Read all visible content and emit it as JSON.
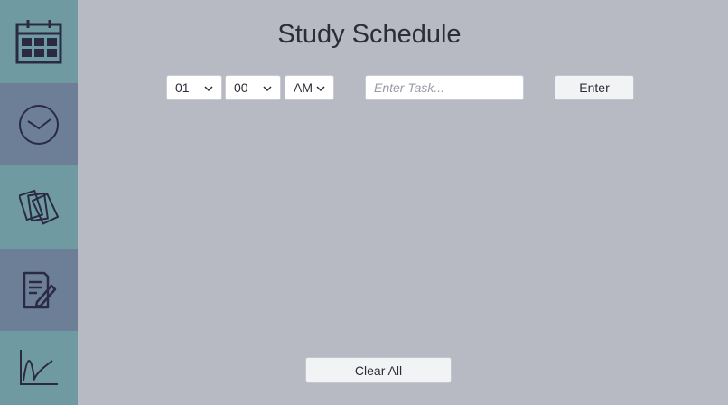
{
  "app": {
    "title": "Study Schedule"
  },
  "sidebar": {
    "items": [
      {
        "name": "calendar",
        "icon": "calendar-icon"
      },
      {
        "name": "clock",
        "icon": "clock-icon"
      },
      {
        "name": "cards",
        "icon": "flashcards-icon"
      },
      {
        "name": "notes",
        "icon": "notes-edit-icon"
      },
      {
        "name": "graph",
        "icon": "graph-icon"
      }
    ],
    "colors": {
      "teal": "#6f9aa1",
      "slate": "#6c7f96"
    }
  },
  "form": {
    "hour": {
      "value": "01"
    },
    "minute": {
      "value": "00"
    },
    "ampm": {
      "value": "AM"
    },
    "task": {
      "placeholder": "Enter Task..."
    },
    "enter_label": "Enter"
  },
  "footer": {
    "clear_label": "Clear All"
  },
  "colors": {
    "background": "#b7bac2",
    "icon_stroke": "#2b2a45"
  }
}
